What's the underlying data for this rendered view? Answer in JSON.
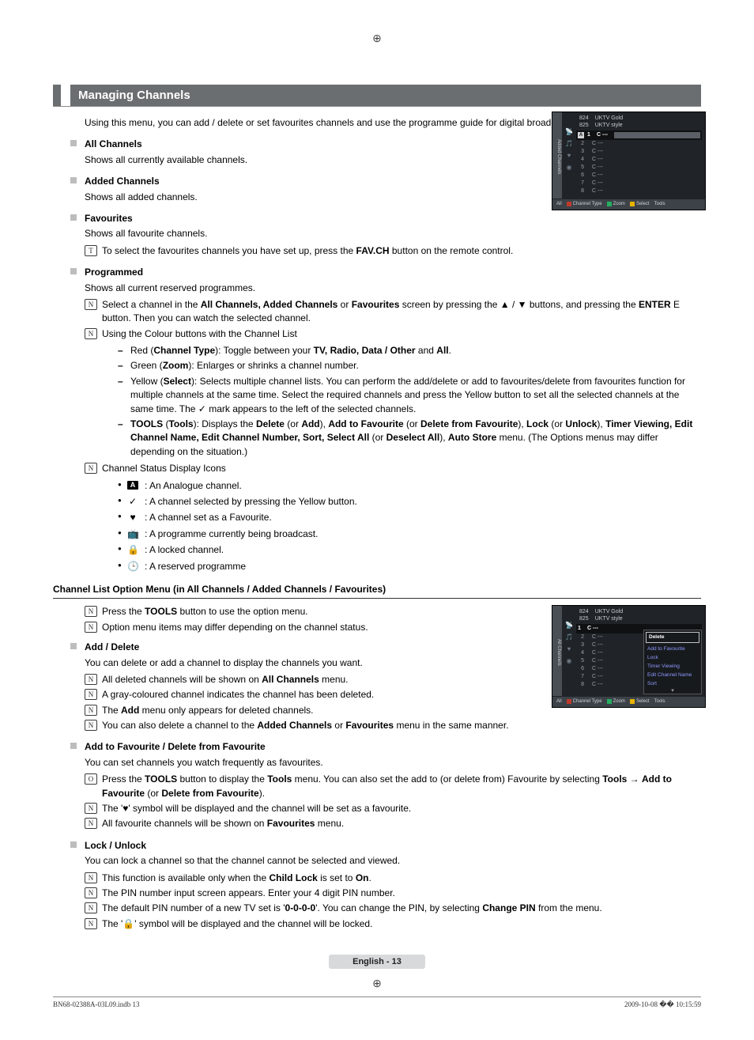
{
  "section_title": "Managing Channels",
  "intro": "Using this menu, you can add / delete or set favourites channels and use the programme guide for digital broadcasts.",
  "items": {
    "all_channels": {
      "head": "All Channels",
      "desc": "Shows all currently available channels."
    },
    "added_channels": {
      "head": "Added Channels",
      "desc": "Shows all added channels."
    },
    "favourites": {
      "head": "Favourites",
      "desc": "Shows all favourite channels.",
      "note_t_pre": "To select the favourites channels you have set up, press the ",
      "note_t_bold": "FAV.CH",
      "note_t_post": " button on the remote control."
    },
    "programmed": {
      "head": "Programmed",
      "desc": "Shows all current reserved programmes."
    }
  },
  "prog_notes": {
    "n1_a": "Select a channel in the ",
    "n1_b": "All Channels, Added Channels",
    "n1_c": " or ",
    "n1_d": "Favourites",
    "n1_e": " screen by pressing the ▲ / ▼ buttons, and pressing the ",
    "n1_f": "ENTER",
    "n1_g": " E button. Then you can watch the selected channel.",
    "n2": "Using the Colour buttons with the Channel List"
  },
  "colour_buttons": {
    "red_a": "Red (",
    "red_b": "Channel Type",
    "red_c": "): Toggle between your ",
    "red_d": "TV, Radio, Data / Other",
    "red_e": " and ",
    "red_f": "All",
    "red_g": ".",
    "green_a": "Green (",
    "green_b": "Zoom",
    "green_c": "): Enlarges or shrinks a channel number.",
    "yellow_a": "Yellow (",
    "yellow_b": "Select",
    "yellow_c": "): Selects multiple channel lists. You can perform the add/delete or add to favourites/delete from favourites function for multiple channels at the same time. Select the required channels and press the Yellow button to set all the selected channels at the same time.  The ✓ mark appears to the left of the selected channels.",
    "tools_a": "TOOLS",
    "tools_b": " (",
    "tools_c": "Tools",
    "tools_d": "): Displays the ",
    "tools_e": "Delete",
    "tools_f": " (or ",
    "tools_g": "Add",
    "tools_h": "), ",
    "tools_i": "Add to Favourite",
    "tools_j": " (or ",
    "tools_k": "Delete from Favourite",
    "tools_l": "), ",
    "tools_m": "Lock",
    "tools_n": " (or ",
    "tools_o": "Unlock",
    "tools_p": "), ",
    "tools_q": "Timer Viewing, Edit Channel Name, Edit Channel Number, Sort, Select All",
    "tools_r": " (or ",
    "tools_s": "Deselect All",
    "tools_t": "), ",
    "tools_u": "Auto Store",
    "tools_v": " menu. (The Options menus may differ depending on the situation.)"
  },
  "status_head": "Channel Status Display Icons",
  "status": {
    "analogue": ": An Analogue channel.",
    "check": ": A channel selected by pressing the Yellow button.",
    "heart": ": A channel set as a Favourite.",
    "broadcast": ": A programme currently being broadcast.",
    "lock": ": A locked channel.",
    "reserved": ": A reserved programme"
  },
  "option_menu_head": "Channel List Option Menu (in All Channels / Added Channels / Favourites)",
  "option_notes": {
    "n1_a": "Press the ",
    "n1_b": "TOOLS",
    "n1_c": " button to use the option menu.",
    "n2": "Option menu items may differ depending on the channel status."
  },
  "add_delete": {
    "head": "Add / Delete",
    "desc": "You can delete or add a channel to display the channels you want.",
    "n1_a": "All deleted channels will be shown on ",
    "n1_b": "All Channels",
    "n1_c": " menu.",
    "n2": "A gray-coloured channel indicates the channel has been deleted.",
    "n3_a": "The ",
    "n3_b": "Add",
    "n3_c": " menu only appears for deleted channels.",
    "n4_a": "You can also delete a channel to the ",
    "n4_b": "Added Channels",
    "n4_c": " or ",
    "n4_d": "Favourites",
    "n4_e": " menu in the same manner."
  },
  "add_fav": {
    "head": "Add to Favourite / Delete from Favourite",
    "desc": "You can set channels you watch frequently as favourites.",
    "t1_a": "Press the ",
    "t1_b": "TOOLS",
    "t1_c": " button to display the ",
    "t1_d": "Tools",
    "t1_e": " menu. You can also set the add to (or delete from) Favourite by selecting ",
    "t1_f": "Tools",
    "t1_g": " → ",
    "t1_h": "Add to Favourite",
    "t1_i": " (or ",
    "t1_j": "Delete from Favourite",
    "t1_k": ").",
    "n1": "The '♥' symbol will be displayed and the channel will be set as a favourite.",
    "n2_a": "All favourite channels will be shown on ",
    "n2_b": "Favourites",
    "n2_c": " menu."
  },
  "lock": {
    "head": "Lock / Unlock",
    "desc": "You can lock a channel so that the channel cannot be selected and viewed.",
    "n1_a": "This function is available only when the ",
    "n1_b": "Child Lock",
    "n1_c": " is set to ",
    "n1_d": "On",
    "n1_e": ".",
    "n2": "The PIN number input screen appears. Enter your 4 digit PIN number.",
    "n3_a": "The default PIN number of a new TV set is '",
    "n3_b": "0-0-0-0",
    "n3_c": "'. You can change the PIN, by selecting ",
    "n3_d": "Change PIN",
    "n3_e": " from the menu.",
    "n4": "The '🔒' symbol will be displayed and the channel will be locked."
  },
  "tv_panel1": {
    "tab": "Added Channels",
    "row824_n": "824",
    "row824_l": "UKTV Gold",
    "row825_n": "825",
    "row825_l": "UKTV style",
    "sel_a": "A",
    "sel_n": "1",
    "sel_l": "C ---",
    "r2n": "2",
    "r2l": "C ---",
    "r3n": "3",
    "r3l": "C ---",
    "r4n": "4",
    "r4l": "C ---",
    "r5n": "5",
    "r5l": "C ---",
    "r6n": "6",
    "r6l": "C ---",
    "r7n": "7",
    "r7l": "C ---",
    "r8n": "8",
    "r8l": "C ---",
    "f_all": "All",
    "f_ct": "Channel Type",
    "f_zoom": "Zoom",
    "f_sel": "Select",
    "f_tools": "Tools"
  },
  "tv_panel2": {
    "tab": "All Channels",
    "row824_n": "824",
    "row824_l": "UKTV Gold",
    "row825_n": "825",
    "row825_l": "UKTV style",
    "sel_n": "1",
    "sel_l": "C ---",
    "r2n": "2",
    "r2l": "C ---",
    "r3n": "3",
    "r3l": "C ---",
    "r4n": "4",
    "r4l": "C ---",
    "r5n": "5",
    "r5l": "C ---",
    "r6n": "6",
    "r6l": "C ---",
    "r7n": "7",
    "r7l": "C ---",
    "r8n": "8",
    "r8l": "C ---",
    "ctx_hdr": "Delete",
    "ctx1": "Add to Favourite",
    "ctx2": "Lock",
    "ctx3": "Timer Viewing",
    "ctx4": "Edit Channel Name",
    "ctx5": "Sort",
    "f_all": "All",
    "f_ct": "Channel Type",
    "f_zoom": "Zoom",
    "f_sel": "Select",
    "f_tools": "Tools"
  },
  "footer_lang": "English - 13",
  "footer_left": "BN68-02388A-03L09.indb   13",
  "footer_right": "2009-10-08   �� 10:15:59",
  "icon_labels": {
    "note_n": "N",
    "tip_t": "T",
    "tools_o": "O"
  }
}
